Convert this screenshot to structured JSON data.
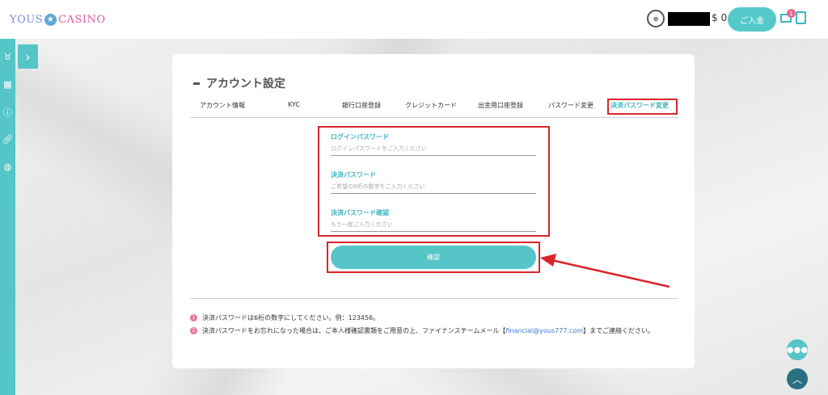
{
  "header": {
    "logo_left": "YOUS",
    "logo_star": "★",
    "logo_right": "CASINO",
    "balance": "$ 0",
    "deposit_label": "ご入金",
    "mail_count": "1"
  },
  "sidebar": {
    "icons": [
      "medal-icon",
      "grid-icon",
      "info-icon",
      "link-icon",
      "globe-icon"
    ]
  },
  "page": {
    "title": "アカウント設定",
    "tabs": [
      {
        "label": "アカウント情報"
      },
      {
        "label": "KYC"
      },
      {
        "label": "銀行口座登録"
      },
      {
        "label": "クレジットカード"
      },
      {
        "label": "出金用口座登録"
      },
      {
        "label": "パスワード変更"
      },
      {
        "label": "決済パスワード変更"
      }
    ],
    "fields": [
      {
        "label": "ログインパスワード",
        "placeholder": "ログインパスワードをご入力ください"
      },
      {
        "label": "決済パスワード",
        "placeholder": "ご希望の6桁の数字をご入力ください"
      },
      {
        "label": "決済パスワード確認",
        "placeholder": "もう一度ご入力ください"
      }
    ],
    "confirm_label": "確認",
    "notes": [
      {
        "num": "1",
        "text": "決済パスワードは6桁の数字にしてください。例：123456。"
      },
      {
        "num": "2",
        "text_before": "決済パスワードをお忘れになった場合は、ご本人様確認書類をご用意の上、ファイナンスチームメール【",
        "email": "financial@yous777.com",
        "text_after": "】までご連絡ください。"
      }
    ]
  },
  "colors": {
    "accent": "#55c5c8",
    "highlight": "#d8262b",
    "badge": "#e77a93"
  }
}
